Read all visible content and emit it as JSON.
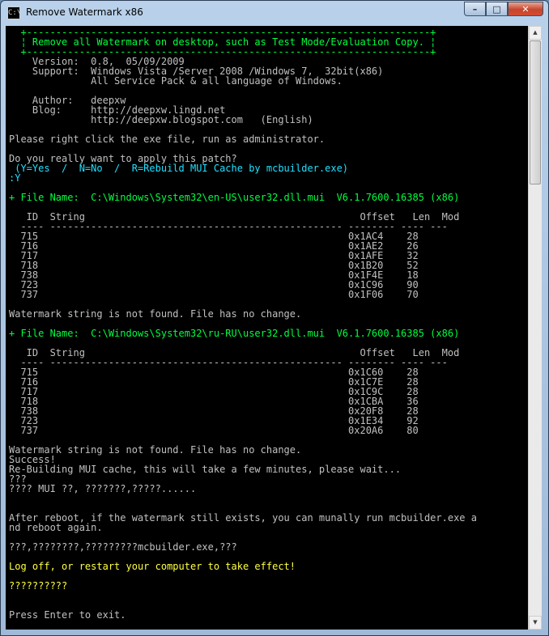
{
  "window": {
    "title": "Remove Watermark x86",
    "icon_name": "console-app-icon",
    "controls": {
      "minimize": "–",
      "maximize": "□",
      "close": "✕"
    }
  },
  "scrollbar": {
    "up": "▲",
    "down": "▼",
    "position": 0.0
  },
  "colors": {
    "console_bg": "#000000",
    "text": "#c0c0c0",
    "green": "#00ff40",
    "cyan": "#20e0ff",
    "yellow": "#ffff40"
  },
  "console": {
    "lines": [
      {
        "text": "  +---------------------------------------------------------------------+",
        "color": "green"
      },
      {
        "text": "  ¦ Remove all Watermark on desktop, such as Test Mode/Evaluation Copy. ¦",
        "color": "green"
      },
      {
        "text": "  +---------------------------------------------------------------------+",
        "color": "green"
      },
      {
        "text": "    Version:  0.8,  05/09/2009",
        "color": "white"
      },
      {
        "text": "    Support:  Windows Vista /Server 2008 /Windows 7,  32bit(x86)",
        "color": "white"
      },
      {
        "text": "              All Service Pack & all language of Windows.",
        "color": "white"
      },
      {
        "text": "",
        "color": "white"
      },
      {
        "text": "    Author:   deepxw",
        "color": "white"
      },
      {
        "text": "    Blog:     http://deepxw.lingd.net",
        "color": "white"
      },
      {
        "text": "              http://deepxw.blogspot.com   (English)",
        "color": "white"
      },
      {
        "text": "",
        "color": "white"
      },
      {
        "text": "Please right click the exe file, run as administrator.",
        "color": "white"
      },
      {
        "text": "",
        "color": "white"
      },
      {
        "text": "Do you really want to apply this patch?",
        "color": "white"
      },
      {
        "text": " (Y=Yes  /  N=No  /  R=Rebuild MUI Cache by mcbuilder.exe)",
        "color": "cyan"
      },
      {
        "text": ":Y",
        "color": "cyan"
      },
      {
        "text": "",
        "color": "white"
      },
      {
        "text": "+ File Name:  C:\\Windows\\System32\\en-US\\user32.dll.mui  V6.1.7600.16385 (x86)",
        "color": "green"
      },
      {
        "text": "",
        "color": "white"
      },
      {
        "text": "   ID  String                                               Offset   Len  Mod",
        "color": "white"
      },
      {
        "text": "  ---- -------------------------------------------------- -------- ---- ---",
        "color": "white"
      },
      {
        "text": "  715                                                     0x1AC4    28",
        "color": "white"
      },
      {
        "text": "  716                                                     0x1AE2    26",
        "color": "white"
      },
      {
        "text": "  717                                                     0x1AFE    32",
        "color": "white"
      },
      {
        "text": "  718                                                     0x1B20    52",
        "color": "white"
      },
      {
        "text": "  738                                                     0x1F4E    18",
        "color": "white"
      },
      {
        "text": "  723                                                     0x1C96    90",
        "color": "white"
      },
      {
        "text": "  737                                                     0x1F06    70",
        "color": "white"
      },
      {
        "text": "",
        "color": "white"
      },
      {
        "text": "Watermark string is not found. File has no change.",
        "color": "white"
      },
      {
        "text": "",
        "color": "white"
      },
      {
        "text": "+ File Name:  C:\\Windows\\System32\\ru-RU\\user32.dll.mui  V6.1.7600.16385 (x86)",
        "color": "green"
      },
      {
        "text": "",
        "color": "white"
      },
      {
        "text": "   ID  String                                               Offset   Len  Mod",
        "color": "white"
      },
      {
        "text": "  ---- -------------------------------------------------- -------- ---- ---",
        "color": "white"
      },
      {
        "text": "  715                                                     0x1C60    28",
        "color": "white"
      },
      {
        "text": "  716                                                     0x1C7E    28",
        "color": "white"
      },
      {
        "text": "  717                                                     0x1C9C    28",
        "color": "white"
      },
      {
        "text": "  718                                                     0x1CBA    36",
        "color": "white"
      },
      {
        "text": "  738                                                     0x20F8    28",
        "color": "white"
      },
      {
        "text": "  723                                                     0x1E34    92",
        "color": "white"
      },
      {
        "text": "  737                                                     0x20A6    80",
        "color": "white"
      },
      {
        "text": "",
        "color": "white"
      },
      {
        "text": "Watermark string is not found. File has no change.",
        "color": "white"
      },
      {
        "text": "Success!",
        "color": "white"
      },
      {
        "text": "Re-Building MUI cache, this will take a few minutes, please wait...",
        "color": "white"
      },
      {
        "text": "???",
        "color": "white"
      },
      {
        "text": "???? MUI ??, ???????,?????......",
        "color": "white"
      },
      {
        "text": "",
        "color": "white"
      },
      {
        "text": "",
        "color": "white"
      },
      {
        "text": "After reboot, if the watermark still exists, you can munally run mcbuilder.exe a",
        "color": "white"
      },
      {
        "text": "nd reboot again.",
        "color": "white"
      },
      {
        "text": "",
        "color": "white"
      },
      {
        "text": "???,????????,?????????mcbuilder.exe,???",
        "color": "white"
      },
      {
        "text": "",
        "color": "white"
      },
      {
        "text": "Log off, or restart your computer to take effect!",
        "color": "yellow"
      },
      {
        "text": "",
        "color": "white"
      },
      {
        "text": "??????????",
        "color": "yellow"
      },
      {
        "text": "",
        "color": "white"
      },
      {
        "text": "",
        "color": "white"
      },
      {
        "text": "Press Enter to exit.",
        "color": "white"
      }
    ]
  }
}
